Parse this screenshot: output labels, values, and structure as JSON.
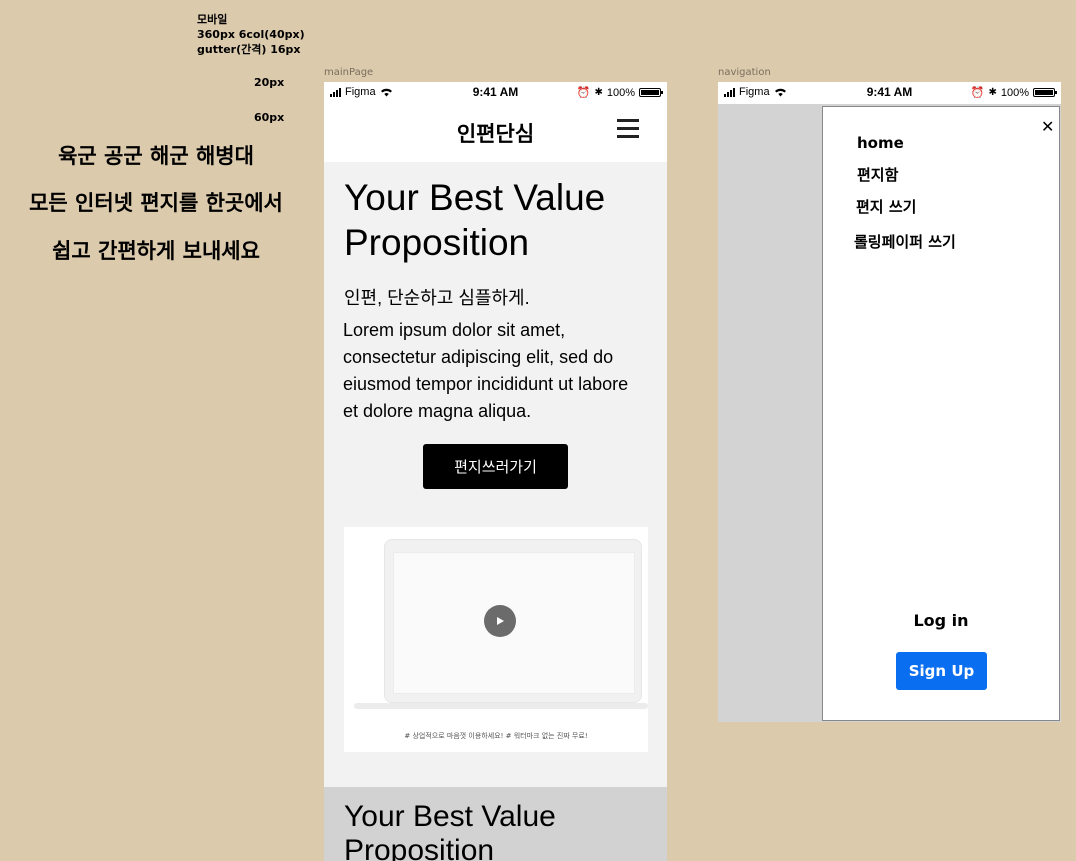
{
  "annotations": {
    "spec_title": "모바일",
    "spec_grid": "360px 6col(40px)",
    "spec_gutter": "gutter(간격) 16px",
    "spacing_20": "20px",
    "spacing_60": "60px"
  },
  "taglines": [
    "육군 공군 해군 해병대",
    "모든 인터넷 편지를 한곳에서",
    "쉽고 간편하게 보내세요"
  ],
  "frames": {
    "main_label": "mainPage",
    "nav_label": "navigation"
  },
  "status_bar": {
    "carrier": "Figma",
    "time": "9:41 AM",
    "battery": "100%"
  },
  "main": {
    "logo": "인편단심",
    "hero_title": "Your Best Value Proposition",
    "hero_subtitle": "인편, 단순하고 심플하게.",
    "hero_body": "Lorem ipsum dolor sit amet, consectetur adipiscing elit, sed do eiusmod tempor incididunt ut labore et dolore magna aliqua.",
    "cta_label": "편지쓰러가기",
    "video_caption": "# 상업적으로 마음껏 이용하세요! # 워터마크 없는 진짜 무료!",
    "section2_title": "Your Best Value Proposition"
  },
  "nav": {
    "items": [
      "home",
      "편지함",
      "편지 쓰기",
      "롤링페이퍼 쓰기"
    ],
    "login_label": "Log in",
    "signup_label": "Sign Up",
    "signup_color": "#0a6ef0"
  },
  "icons": {
    "menu": "hamburger-icon",
    "close": "close-icon",
    "play": "play-icon",
    "wifi": "wifi-icon",
    "signal": "signal-icon",
    "alarm": "alarm-icon",
    "bluetooth": "bluetooth-icon",
    "battery": "battery-icon"
  }
}
